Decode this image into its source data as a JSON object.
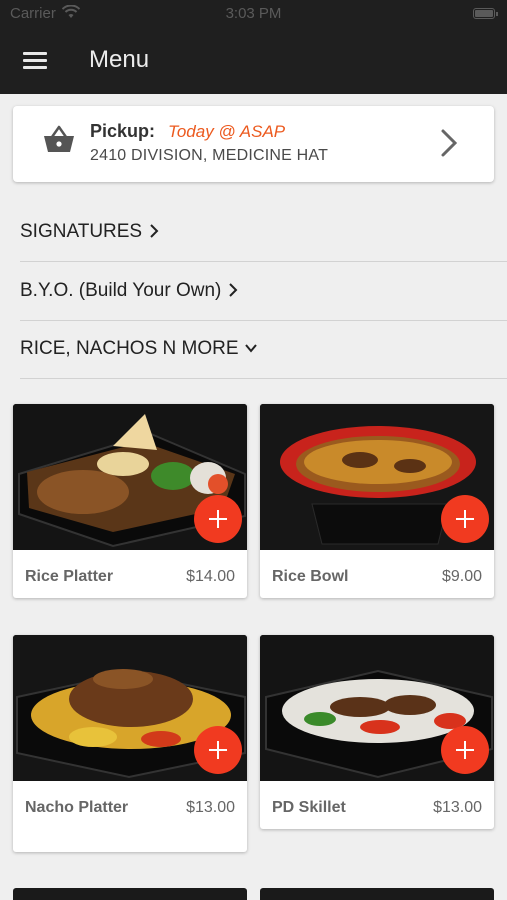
{
  "status_bar": {
    "carrier": "Carrier",
    "time": "3:03 PM"
  },
  "header": {
    "title": "Menu",
    "menu_icon": "hamburger-icon"
  },
  "pickup": {
    "label": "Pickup:",
    "time": "Today @ ASAP",
    "address": "2410 DIVISION, MEDICINE HAT",
    "icon": "basket-icon"
  },
  "categories": [
    {
      "label": "SIGNATURES",
      "chevron": "chevron-right-icon"
    },
    {
      "label": "B.Y.O. (Build Your Own)",
      "chevron": "chevron-right-icon"
    },
    {
      "label": "RICE, NACHOS N MORE",
      "chevron": "chevron-down-icon"
    }
  ],
  "items": [
    {
      "name": "Rice Platter",
      "price": "$14.00"
    },
    {
      "name": "Rice Bowl",
      "price": "$9.00"
    },
    {
      "name": "Nacho Platter",
      "price": "$13.00"
    },
    {
      "name": "PD Skillet",
      "price": "$13.00"
    }
  ],
  "colors": {
    "accent": "#f13a20",
    "pickup_time": "#ec5a1f",
    "header_bg": "#1f1f1f"
  }
}
